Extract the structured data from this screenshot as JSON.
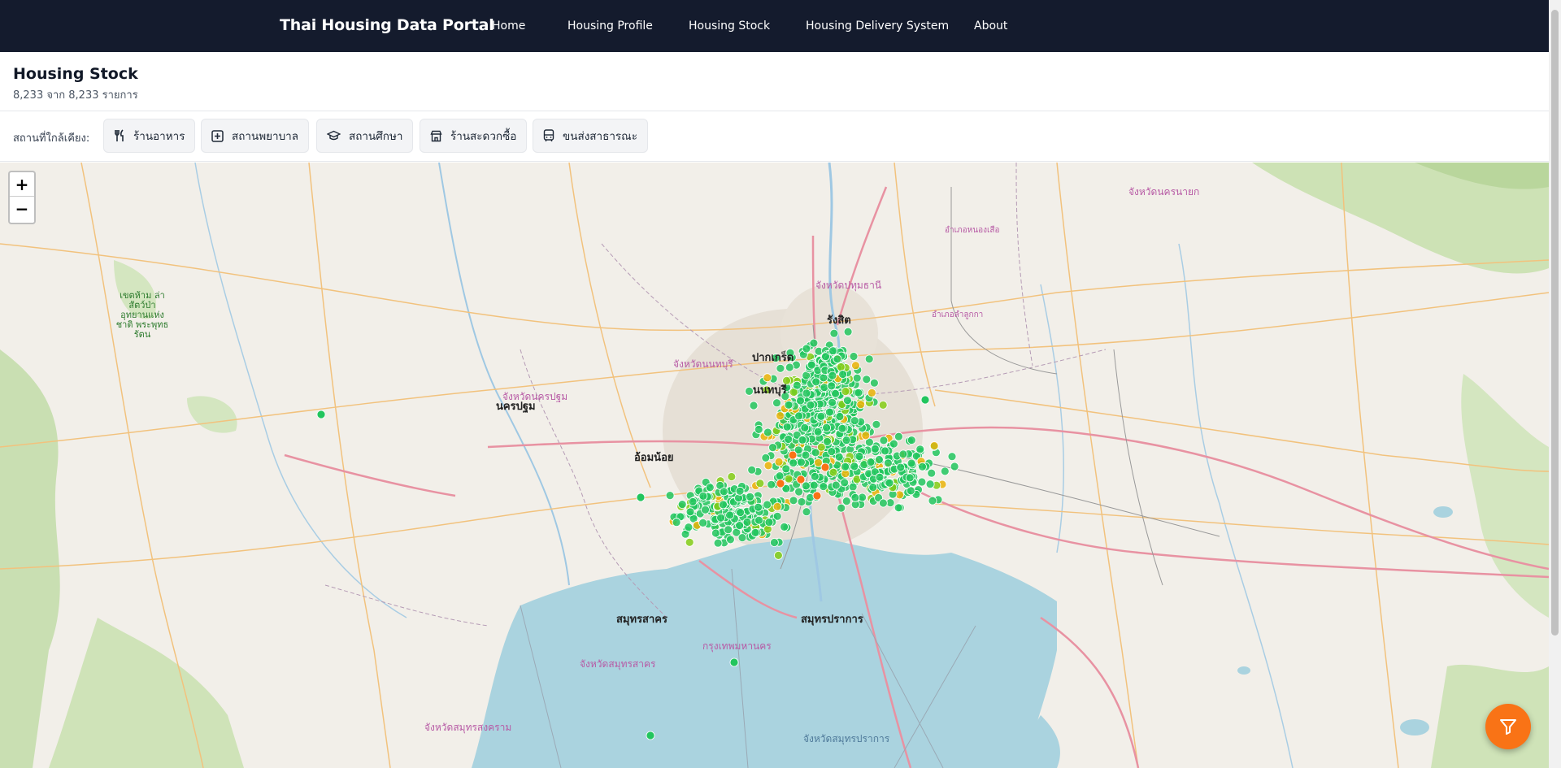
{
  "nav": {
    "brand": "Thai Housing Data Portal",
    "links": [
      "Home",
      "Housing Profile",
      "Housing Stock",
      "Housing Delivery System",
      "About"
    ]
  },
  "header": {
    "title": "Housing Stock",
    "count": "8,233 จาก 8,233 รายการ"
  },
  "filters": {
    "label": "สถานที่ใกล้เคียง:",
    "chips": [
      {
        "label": "ร้านอาหาร",
        "icon": "fork-knife-icon"
      },
      {
        "label": "สถานพยาบาล",
        "icon": "hospital-icon"
      },
      {
        "label": "สถานศึกษา",
        "icon": "graduation-cap-icon"
      },
      {
        "label": "ร้านสะดวกซื้อ",
        "icon": "store-icon"
      },
      {
        "label": "ขนส่งสาธารณะ",
        "icon": "bus-icon"
      }
    ]
  },
  "map": {
    "zoom_in": "+",
    "zoom_out": "−",
    "labels": {
      "nonthaburi_prov": "จังหวัดนนทบุรี",
      "pathum_prov": "จังหวัดปทุมธานี",
      "nakhonpathom_prov": "จังหวัดนครปฐม",
      "bangkok": "กรุงเทพมหานคร",
      "samutprakan_prov": "จังหวัดสมุทรปราการ",
      "samutsakhon_prov": "จังหวัดสมุทรสาคร",
      "samutsongkhram_prov": "จังหวัดสมุทรสงคราม",
      "nakhonnayok_prov": "จังหวัดนครนายก",
      "rangsit": "รังสิต",
      "pakkret": "ปากเกร็ด",
      "nonthaburi": "นนทบุรี",
      "nakhonpathom": "นครปฐม",
      "samutsakhon": "สมุทรสาคร",
      "samutprakan": "สมุทรปราการ",
      "omnoi": "อ้อมน้อย",
      "nongsuea": "อำเภอหนองเสือ",
      "lamlukka": "อำเภอลำลูกกา",
      "park": "เขตห้าม ล่าสัตว์ป่า อุทยานแห่งชาติ พระพุทธรัตน"
    },
    "dot_colors": {
      "green": "#22c55e",
      "lime": "#84cc16",
      "yellow": "#eab308",
      "orange": "#f97316"
    }
  },
  "fab": {
    "icon": "filter-icon"
  }
}
